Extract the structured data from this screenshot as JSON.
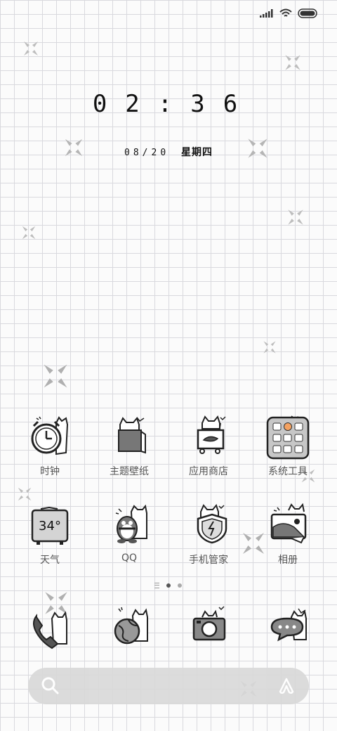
{
  "status_bar": {
    "icons": [
      "signal-icon",
      "wifi-icon",
      "battery-icon"
    ]
  },
  "lock": {
    "time": "02:36",
    "date": "08/20",
    "weekday": "星期四"
  },
  "apps_row1": [
    {
      "label": "时钟",
      "icon": "clock-icon"
    },
    {
      "label": "主题壁纸",
      "icon": "theme-icon"
    },
    {
      "label": "应用商店",
      "icon": "app-store-icon"
    },
    {
      "label": "系统工具",
      "icon": "system-tools-folder-icon"
    }
  ],
  "apps_row2": [
    {
      "label": "天气",
      "icon": "weather-icon",
      "value": "34°"
    },
    {
      "label": "QQ",
      "icon": "qq-icon"
    },
    {
      "label": "手机管家",
      "icon": "security-icon"
    },
    {
      "label": "相册",
      "icon": "gallery-icon"
    }
  ],
  "dock": [
    {
      "icon": "phone-icon"
    },
    {
      "icon": "browser-icon"
    },
    {
      "icon": "camera-icon"
    },
    {
      "icon": "messages-icon"
    }
  ],
  "page_indicator": {
    "pages": 2,
    "active": 1
  },
  "search": {
    "icons": [
      "search-icon",
      "assistant-icon"
    ]
  }
}
